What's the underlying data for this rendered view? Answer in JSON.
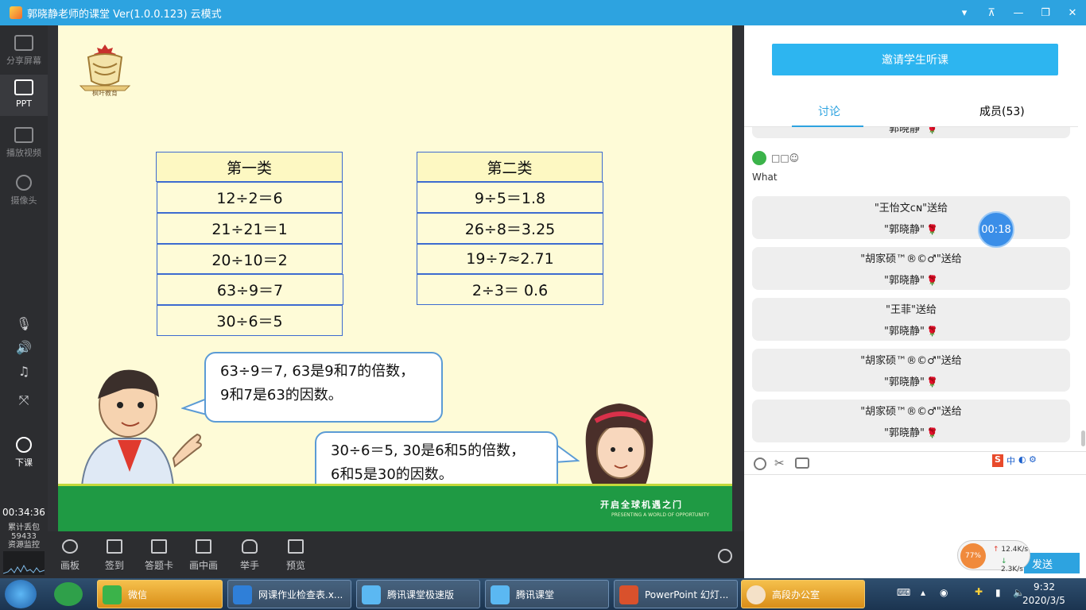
{
  "window": {
    "title": "郭晓静老师的课堂 Ver(1.0.0.123)  云模式",
    "controls": [
      "▾",
      "⊼",
      "—",
      "❐",
      "✕"
    ]
  },
  "leftbar": {
    "items": [
      {
        "label": "分享屏幕",
        "icon": "share-screen-icon"
      },
      {
        "label": "PPT",
        "icon": "ppt-icon"
      },
      {
        "label": "播放视频",
        "icon": "play-video-icon"
      },
      {
        "label": "摄像头",
        "icon": "camera-icon"
      }
    ],
    "end_class": "下课",
    "elapsed": "00:34:36",
    "lost_packets_label": "累计丢包",
    "lost_packets": "59433",
    "monitor_label": "资源监控"
  },
  "slide": {
    "logo_text": "枫叶教育",
    "table1": {
      "header": "第一类",
      "rows": [
        "12÷2＝6",
        "21÷21＝1",
        "20÷10＝2",
        "63÷9＝7",
        "30÷6＝5"
      ]
    },
    "table2": {
      "header": "第二类",
      "rows": [
        "9÷5＝1.8",
        "26÷8＝3.25",
        "19÷7≈2.71",
        "2÷3＝ 0.6̇"
      ]
    },
    "bubble1": {
      "line1": "63÷9＝7, 63是9和7的倍数，",
      "line2": "9和7是63的因数。"
    },
    "bubble2": {
      "line1": "30÷6＝5, 30是6和5的倍数，",
      "line2": "6和5是30的因数。"
    },
    "slogan": "开启全球机遇之门",
    "slogan_en": "PRESENTING A WORLD OF OPPORTUNITY"
  },
  "bottombar": {
    "items": [
      "画板",
      "签到",
      "答题卡",
      "画中画",
      "举手",
      "预览"
    ]
  },
  "right": {
    "invite": "邀请学生听课",
    "tabs": [
      "讨论",
      "成员(53)"
    ],
    "partial_top": "\"郭晓静\"",
    "chat_user": "□□☺",
    "chat_text": "What",
    "gifts": [
      {
        "from": "\"王怡文ᴄɴ\"送给",
        "to": "\"郭晓静\""
      },
      {
        "from": "\"胡家硕™®©♂\"送给",
        "to": "\"郭晓静\""
      },
      {
        "from": "\"王菲\"送给",
        "to": "\"郭晓静\""
      },
      {
        "from": "\"胡家硕™®©♂\"送给",
        "to": "\"郭晓静\""
      },
      {
        "from": "\"胡家硕™®©♂\"送给",
        "to": "\"郭晓静\""
      }
    ],
    "rose_icon": "🌹",
    "timer": "00:18",
    "ime": "中",
    "send": "发送",
    "net_percent": "77%",
    "net_up": "12.4K/s",
    "net_down": "2.3K/s"
  },
  "taskbar": {
    "tasks": [
      "微信",
      "网课作业检查表.x...",
      "腾讯课堂极速版",
      "腾讯课堂",
      "PowerPoint 幻灯...",
      "高段办公室"
    ],
    "time": "9:32",
    "date": "2020/3/5"
  }
}
